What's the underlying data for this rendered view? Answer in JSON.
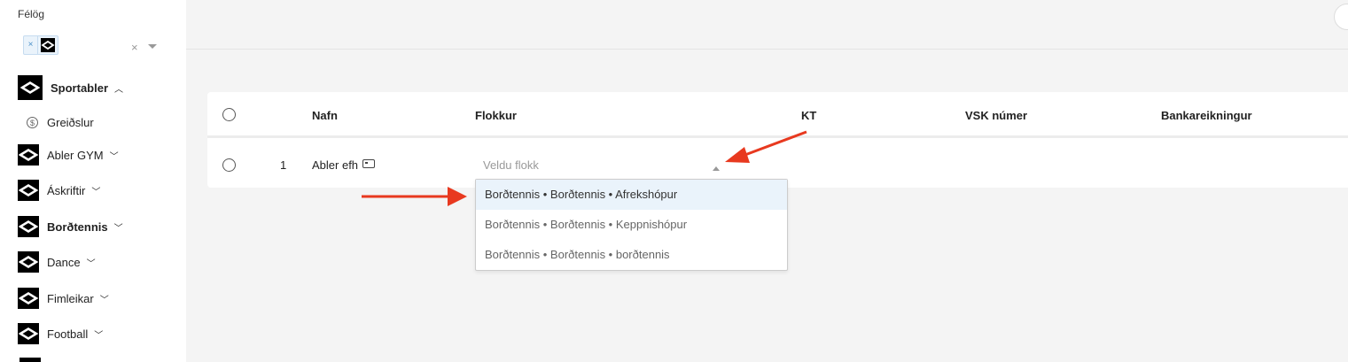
{
  "sidebar": {
    "label": "Félög",
    "tag_remove": "×",
    "clear": "×",
    "items": [
      {
        "label": "Sportabler",
        "bold": true,
        "chevron": "up"
      },
      {
        "label": "Greiðslur",
        "icon": "dollar-circle-icon"
      },
      {
        "label": "Abler GYM",
        "chevron": "down"
      },
      {
        "label": "Áskriftir",
        "chevron": "down"
      },
      {
        "label": "Borðtennis",
        "bold": true,
        "chevron": "down"
      },
      {
        "label": "Dance",
        "chevron": "down"
      },
      {
        "label": "Fimleikar",
        "chevron": "down"
      },
      {
        "label": "Football",
        "chevron": "down"
      }
    ]
  },
  "table": {
    "headers": [
      "Nafn",
      "Flokkur",
      "KT",
      "VSK númer",
      "Bankareikningur"
    ],
    "rows": [
      {
        "index": "1",
        "name": "Abler efh",
        "category_placeholder": "Veldu flokk"
      }
    ]
  },
  "dropdown": {
    "options": [
      "Borðtennis • Borðtennis • Afrekshópur",
      "Borðtennis • Borðtennis • Keppnishópur",
      "Borðtennis • Borðtennis • borðtennis"
    ],
    "highlighted_index": 0
  },
  "colors": {
    "annotation_arrow": "#e8391f",
    "highlight": "#eaf3fb",
    "tag_border": "#c6dcf0"
  }
}
